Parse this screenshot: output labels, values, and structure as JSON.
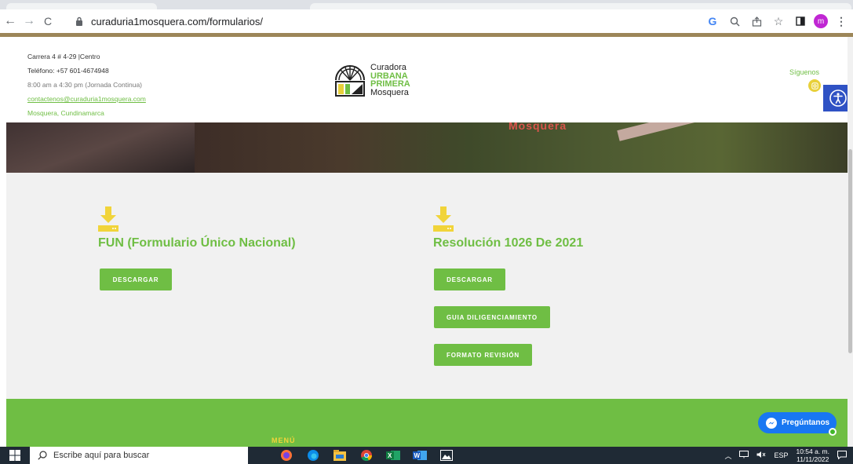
{
  "browser": {
    "url": "curaduria1mosquera.com/formularios/",
    "back": "←",
    "forward": "→",
    "reload": "C",
    "profile_initial": "m",
    "icons": [
      "google-icon",
      "zoom-icon",
      "share-icon",
      "star-icon",
      "sidepanel-icon",
      "profile-avatar",
      "menu-icon"
    ]
  },
  "header": {
    "address": "Carrera 4 # 4-29 |Centro",
    "phone": "Teléfono: +57 601-4674948",
    "hours": "8:00 am a 4:30 pm (Jornada Continua)",
    "email": "contactenos@curaduria1mosquera.com",
    "city": "Mosquera, Cundinamarca",
    "logo": {
      "line1": "Curadora",
      "line2": "URBANA",
      "line3": "PRIMERA",
      "line4": "Mosquera"
    },
    "follow_label": "Síguenos"
  },
  "hero": {
    "sign": "Mosquera"
  },
  "cards": [
    {
      "title": "FUN (Formulario Único Nacional)",
      "buttons": [
        "DESCARGAR"
      ]
    },
    {
      "title": "Resolución 1026 De 2021",
      "buttons": [
        "DESCARGAR",
        "GUIA DILIGENCIAMIENTO",
        "FORMATO REVISIÓN"
      ]
    }
  ],
  "footer": {
    "menu_label": "MENÚ"
  },
  "chat": {
    "label": "Pregúntanos"
  },
  "taskbar": {
    "search_placeholder": "Escribe aquí para buscar",
    "lang": "ESP",
    "time": "10:54 a. m.",
    "date": "11/11/2022"
  },
  "colors": {
    "brand_green": "#6fbe44",
    "accent_yellow": "#f1d43a",
    "access_blue": "#2f52c4"
  }
}
